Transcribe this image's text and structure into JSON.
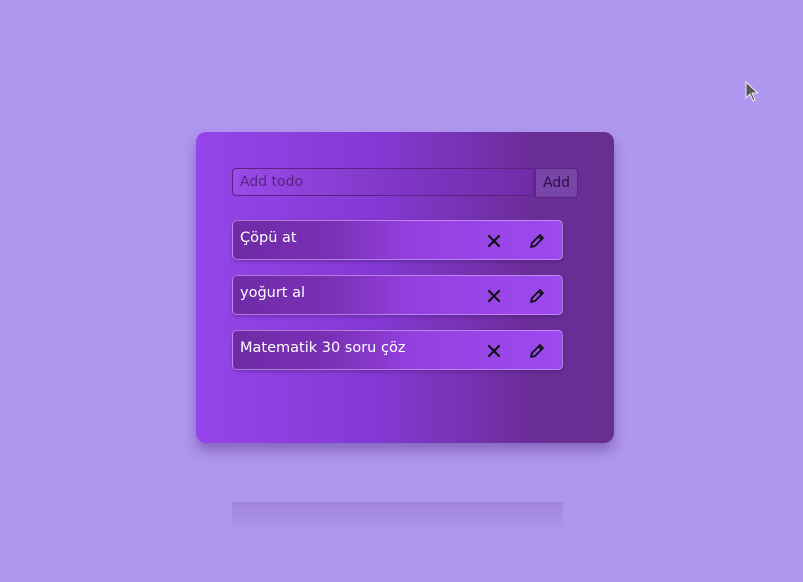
{
  "add_form": {
    "placeholder": "Add todo",
    "value": "",
    "button_label": "Add"
  },
  "todos": [
    {
      "text": "Çöpü at",
      "delete_icon": "close-icon",
      "edit_icon": "pencil-icon"
    },
    {
      "text": "yoğurt al",
      "delete_icon": "close-icon",
      "edit_icon": "pencil-icon"
    },
    {
      "text": "Matematik 30 soru çöz",
      "delete_icon": "close-icon",
      "edit_icon": "pencil-icon"
    }
  ],
  "colors": {
    "background": "#af96ef",
    "card_start": "#9545ea",
    "card_end": "#672f92",
    "text": "#ffffff",
    "icon": "#111111"
  }
}
